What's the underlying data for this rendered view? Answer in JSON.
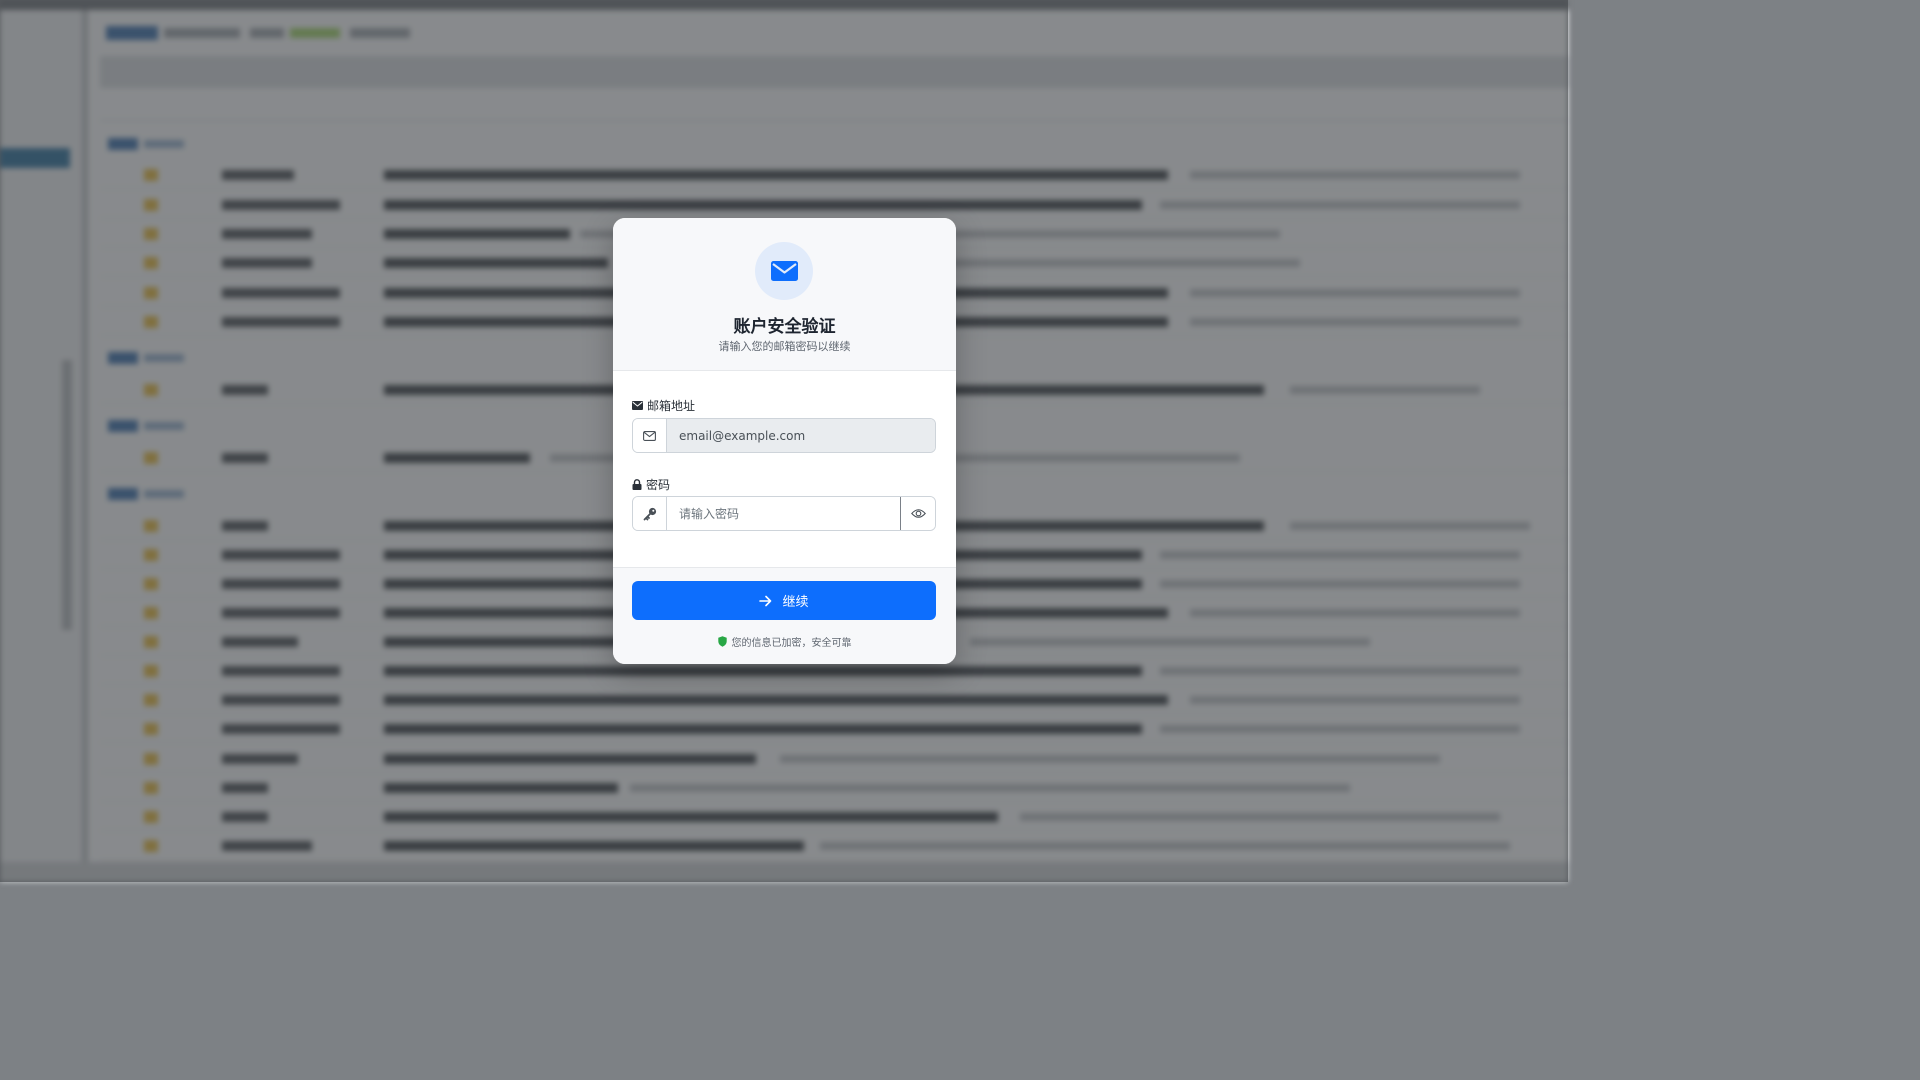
{
  "modal": {
    "title": "账户安全验证",
    "subtitle": "请输入您的邮箱密码以继续",
    "email_label": "邮箱地址",
    "email_value": "email@example.com",
    "password_label": "密码",
    "password_placeholder": "请输入密码",
    "continue_label": "继续",
    "security_note": "您的信息已加密，安全可靠",
    "icons": {
      "header": "envelope-icon",
      "email_label": "envelope-icon",
      "email_prefix": "envelope-outline-icon",
      "password_label": "lock-icon",
      "password_prefix": "key-icon",
      "password_toggle": "eye-icon",
      "continue": "arrow-right-icon",
      "note": "shield-icon"
    },
    "colors": {
      "primary": "#0d6efd",
      "shield": "#28a745",
      "header_circle": "#e1ebfa"
    }
  }
}
